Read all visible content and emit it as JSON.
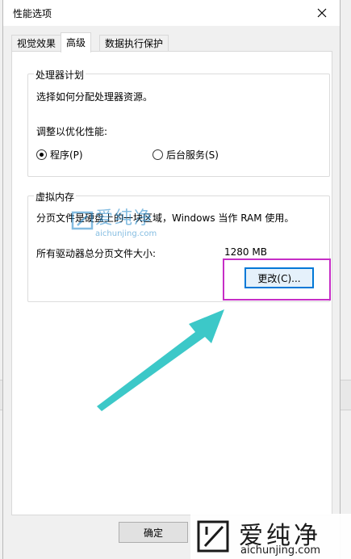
{
  "dialog": {
    "title": "性能选项"
  },
  "tabs": [
    {
      "label": "视觉效果",
      "active": false
    },
    {
      "label": "高级",
      "active": true
    },
    {
      "label": "数据执行保护",
      "active": false
    }
  ],
  "processor": {
    "group_title": "处理器计划",
    "description": "选择如何分配处理器资源。",
    "adjust_label": "调整以优化性能:",
    "options": [
      {
        "label": "程序(P)",
        "selected": true
      },
      {
        "label": "后台服务(S)",
        "selected": false
      }
    ]
  },
  "virtual_memory": {
    "group_title": "虚拟内存",
    "description": "分页文件是硬盘上的一块区域，Windows 当作 RAM 使用。",
    "total_label": "所有驱动器总分页文件大小:",
    "total_value": "1280 MB",
    "change_button": "更改(C)..."
  },
  "footer": {
    "ok_button": "确定"
  },
  "watermark": {
    "cn": "爱纯净",
    "url": "aichunjing.com"
  },
  "colors": {
    "highlight": "#c62ec6",
    "arrow": "#3cc8c8",
    "focus": "#0078d7"
  }
}
